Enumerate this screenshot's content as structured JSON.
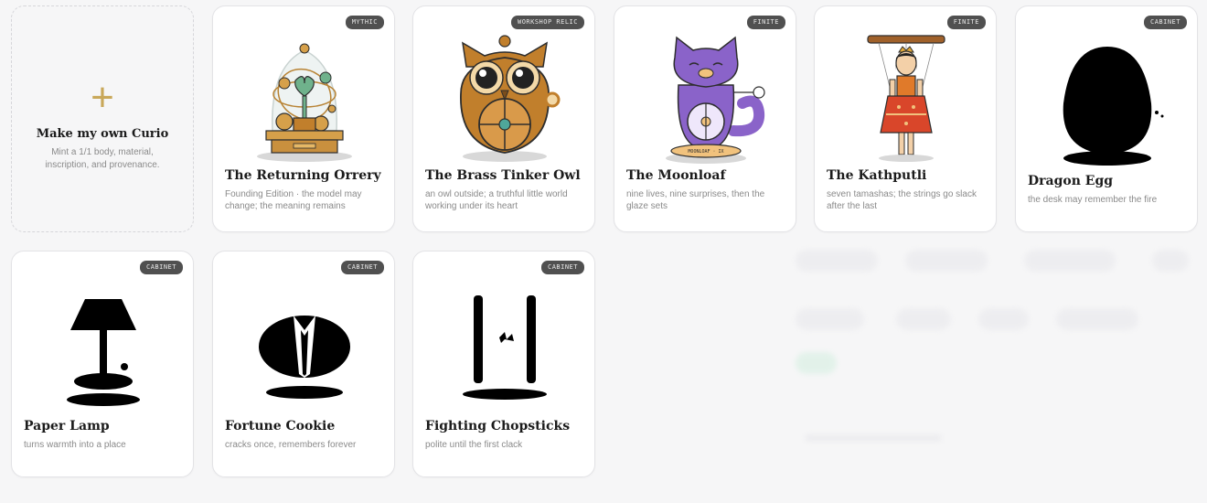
{
  "create_card": {
    "plus": "+",
    "title": "Make my own Curio",
    "subtitle": "Mint a 1/1 body, material, inscription, and provenance."
  },
  "curios": [
    {
      "title": "The Returning Orrery",
      "subtitle": "Founding Edition · the model may change; the meaning remains",
      "badge": "MYTHIC",
      "icon": "orrery-icon"
    },
    {
      "title": "The Brass Tinker Owl",
      "subtitle": "an owl outside; a truthful little world working under its heart",
      "badge": "WORKSHOP RELIC",
      "icon": "brass-owl-icon"
    },
    {
      "title": "The Moonloaf",
      "subtitle": "nine lives, nine surprises, then the glaze sets",
      "badge": "FINITE",
      "icon": "moon-cat-icon",
      "plaque": "MOONLOAF · IX"
    },
    {
      "title": "The Kathputli",
      "subtitle": "seven tamashas; the strings go slack after the last",
      "badge": "FINITE",
      "icon": "puppet-icon"
    },
    {
      "title": "Dragon Egg",
      "subtitle": "the desk may remember the fire",
      "badge": "CABINET",
      "icon": "dragon-egg-silhouette-icon"
    },
    {
      "title": "Paper Lamp",
      "subtitle": "turns warmth into a place",
      "badge": "CABINET",
      "icon": "lamp-silhouette-icon"
    },
    {
      "title": "Fortune Cookie",
      "subtitle": "cracks once, remembers forever",
      "badge": "CABINET",
      "icon": "fortune-cookie-silhouette-icon"
    },
    {
      "title": "Fighting Chopsticks",
      "subtitle": "polite until the first clack",
      "badge": "CABINET",
      "icon": "chopsticks-silhouette-icon"
    }
  ],
  "colors": {
    "accent": "#c9a85a",
    "badge_bg": "#505050",
    "brass": "#c17f2c",
    "violet": "#8a63c9"
  }
}
